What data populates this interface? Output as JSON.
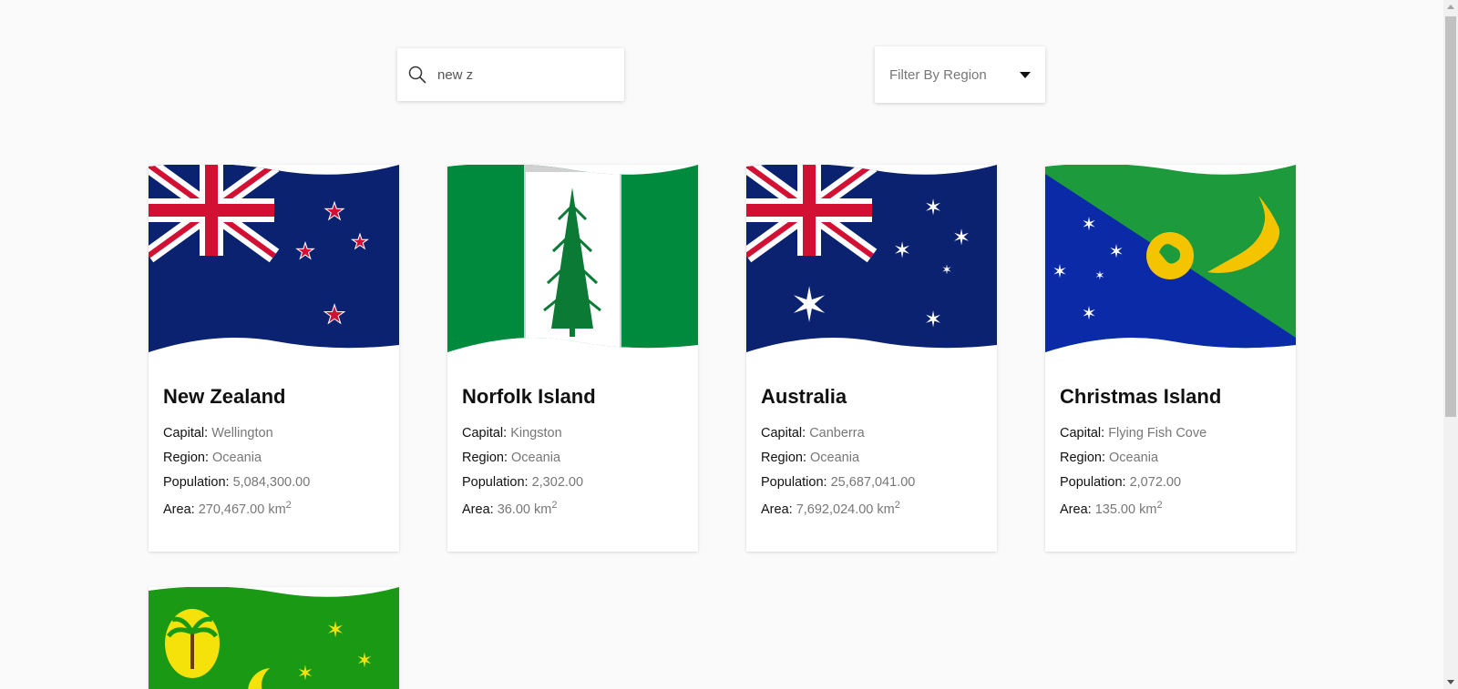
{
  "search": {
    "value": "new z",
    "icon": "search-icon"
  },
  "filter": {
    "label": "Filter By Region",
    "icon": "caret-down-icon"
  },
  "labels": {
    "capital": "Capital:",
    "region": "Region:",
    "population": "Population:",
    "area": "Area:",
    "area_unit": "km",
    "area_exp": "2"
  },
  "countries": [
    {
      "name": "New Zealand",
      "capital": "Wellington",
      "region": "Oceania",
      "population": "5,084,300.00",
      "area": "270,467.00"
    },
    {
      "name": "Norfolk Island",
      "capital": "Kingston",
      "region": "Oceania",
      "population": "2,302.00",
      "area": "36.00"
    },
    {
      "name": "Australia",
      "capital": "Canberra",
      "region": "Oceania",
      "population": "25,687,041.00",
      "area": "7,692,024.00"
    },
    {
      "name": "Christmas Island",
      "capital": "Flying Fish Cove",
      "region": "Oceania",
      "population": "2,072.00",
      "area": "135.00"
    }
  ],
  "colors": {
    "background": "#fafafa",
    "card": "#ffffff",
    "muted_text": "#777777"
  }
}
